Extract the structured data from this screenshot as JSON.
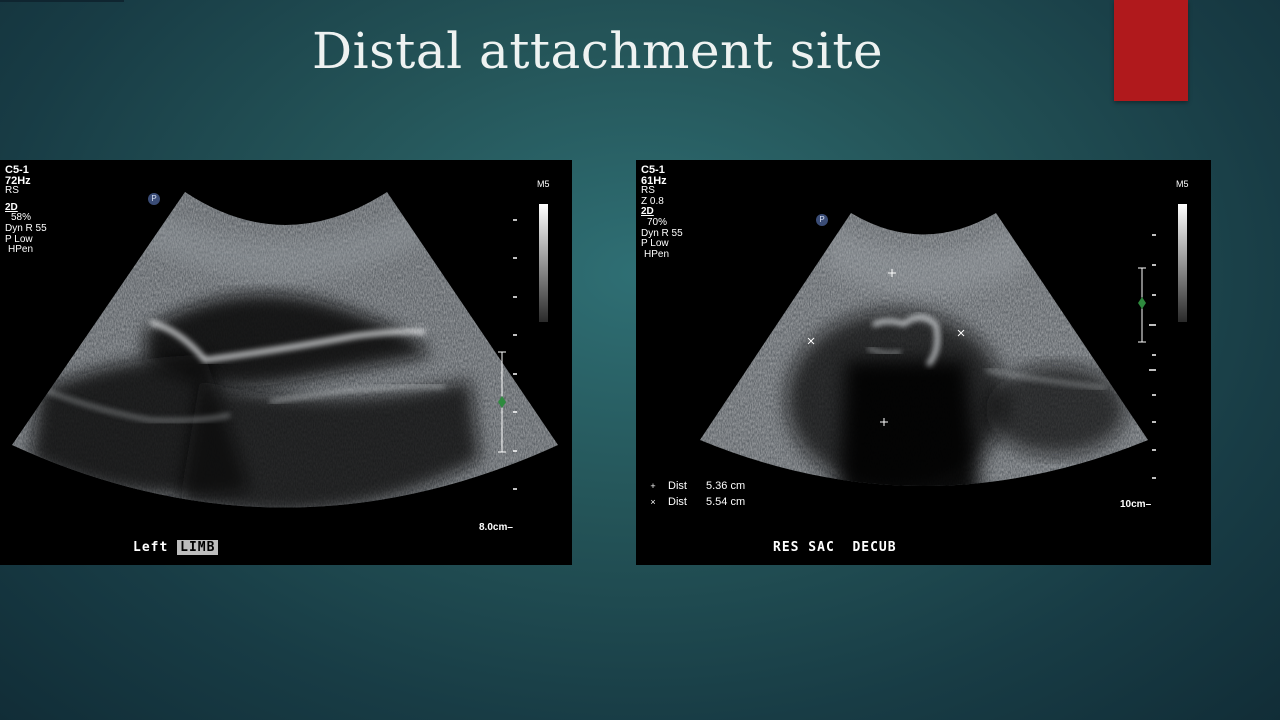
{
  "slide": {
    "title": "Distal attachment site",
    "accent_color": "#b0191c"
  },
  "left_image": {
    "probe": "C5-1",
    "frame_rate": "72Hz",
    "mode_line1": "RS",
    "mode_2d": "2D",
    "gain": "58%",
    "dyn_range": "Dyn R 55",
    "persist": "P Low",
    "freq": "HPen",
    "map": "M5",
    "marker": "P",
    "depth": "8.0cm",
    "caption_word": "Left",
    "caption_highlight": "LIMB"
  },
  "right_image": {
    "probe": "C5-1",
    "frame_rate": "61Hz",
    "mode_line1": "RS",
    "zoom": "Z 0.8",
    "mode_2d": "2D",
    "gain": "70%",
    "dyn_range": "Dyn R 55",
    "persist": "P Low",
    "freq": "HPen",
    "map": "M5",
    "marker": "P",
    "depth": "10cm",
    "caption": "RES SAC  DECUB",
    "measurements": [
      {
        "symbol": "+",
        "label": "Dist",
        "value": "5.36 cm"
      },
      {
        "symbol": "×",
        "label": "Dist",
        "value": "5.54 cm"
      }
    ]
  }
}
